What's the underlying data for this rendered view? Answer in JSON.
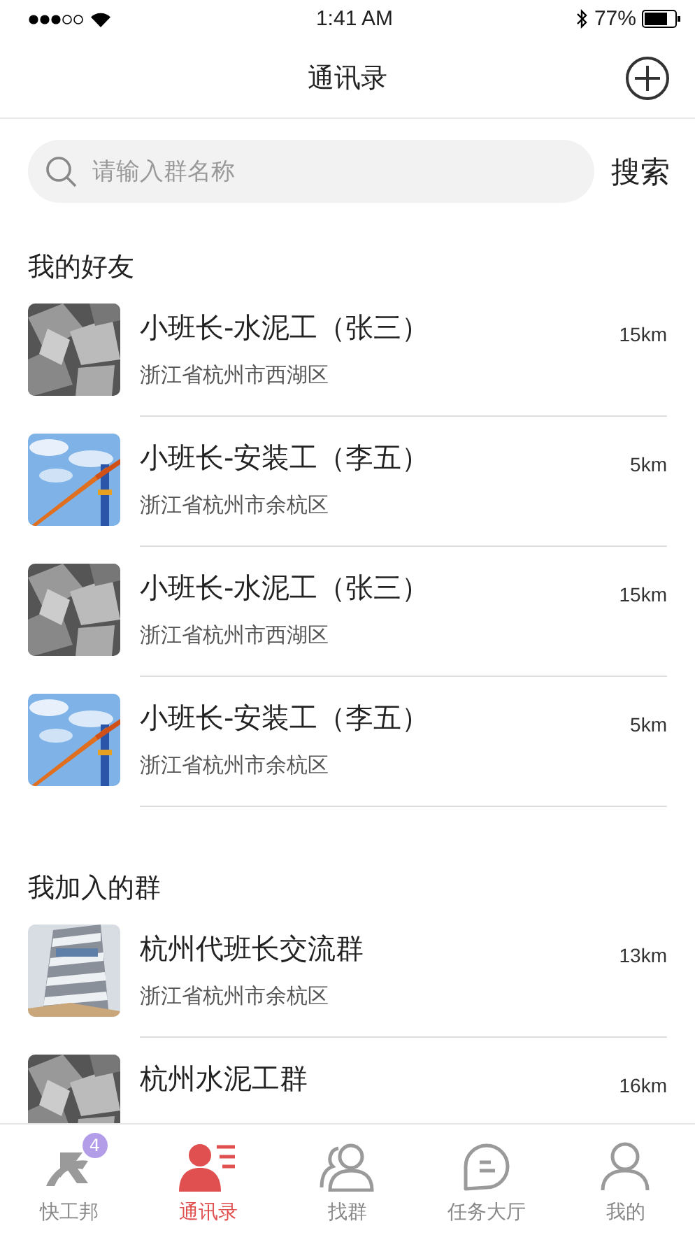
{
  "status_bar": {
    "time": "1:41 AM",
    "battery": "77%"
  },
  "nav": {
    "title": "通讯录"
  },
  "search": {
    "placeholder": "请输入群名称",
    "button": "搜索"
  },
  "sections": [
    {
      "title": "我的好友",
      "items": [
        {
          "name": "小班长-水泥工（张三）",
          "address": "浙江省杭州市西湖区",
          "distance": "15km"
        },
        {
          "name": "小班长-安装工（李五）",
          "address": "浙江省杭州市余杭区",
          "distance": "5km"
        },
        {
          "name": "小班长-水泥工（张三）",
          "address": "浙江省杭州市西湖区",
          "distance": "15km"
        },
        {
          "name": "小班长-安装工（李五）",
          "address": "浙江省杭州市余杭区",
          "distance": "5km"
        }
      ]
    },
    {
      "title": "我加入的群",
      "items": [
        {
          "name": "杭州代班长交流群",
          "address": "浙江省杭州市余杭区",
          "distance": "13km"
        },
        {
          "name": "杭州水泥工群",
          "distance": "16km"
        }
      ]
    }
  ],
  "tab_bar": [
    {
      "label": "快工邦",
      "selected": false,
      "badge": "4"
    },
    {
      "label": "通讯录",
      "selected": true
    },
    {
      "label": "找群",
      "selected": false
    },
    {
      "label": "任务大厅",
      "selected": false
    },
    {
      "label": "我的",
      "selected": false
    }
  ]
}
